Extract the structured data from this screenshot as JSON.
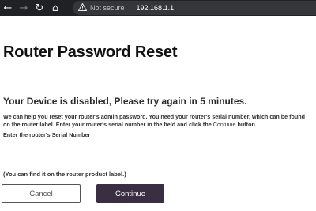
{
  "browser": {
    "back_icon": "←",
    "forward_icon": "→",
    "reload_icon": "↻",
    "home_icon": "⌂",
    "security_label": "Not secure",
    "address": "192.168.1.1"
  },
  "page": {
    "title": "Router Password Reset",
    "disabled_message": "Your Device is disabled, Please try again in 5 minutes.",
    "help_text_before": "We can help you reset your router's admin password. You need your router's serial number, which can be found on the router label. Enter your router's serial number in the field and click the ",
    "help_text_link": "Continue",
    "help_text_after": " button.",
    "serial_label": "Enter the router's Serial Number",
    "serial_value": "",
    "hint": "(You can find it on the router product label.)",
    "cancel_label": "Cancel",
    "continue_label": "Continue"
  },
  "colors": {
    "browser_bar": "#202124",
    "omnibox": "#35363a",
    "continue_button": "#3a2e43"
  }
}
